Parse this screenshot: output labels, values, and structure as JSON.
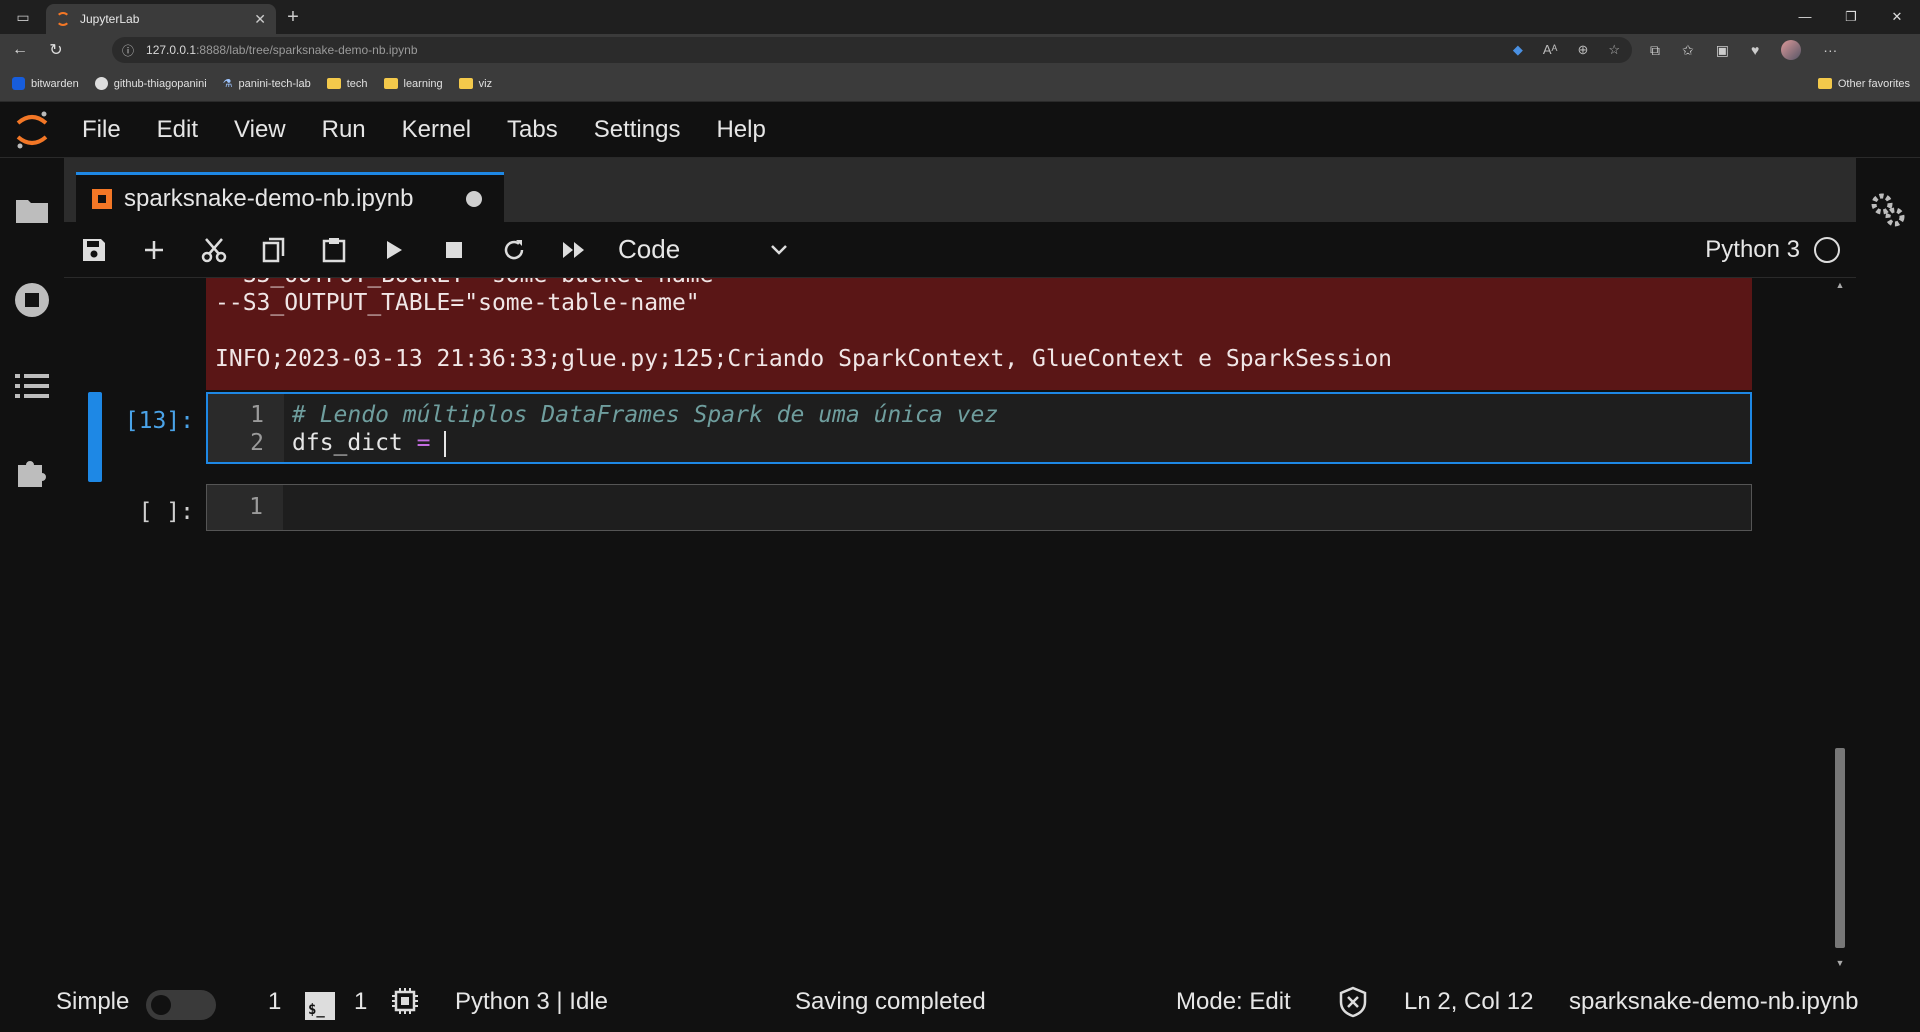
{
  "browser": {
    "tab_title": "JupyterLab",
    "url_host": "127.0.0.1",
    "url_rest": ":8888/lab/tree/sparksnake-demo-nb.ipynb",
    "bookmarks": [
      "bitwarden",
      "github-thiagopanini",
      "panini-tech-lab",
      "tech",
      "learning",
      "viz"
    ],
    "other_favorites": "Other favorites"
  },
  "menu": [
    "File",
    "Edit",
    "View",
    "Run",
    "Kernel",
    "Tabs",
    "Settings",
    "Help"
  ],
  "notebook": {
    "tab_title": "sparksnake-demo-nb.ipynb",
    "cell_type": "Code",
    "kernel": "Python 3"
  },
  "output": {
    "line_partial": "--S3_OUTPUT_BUCKET=\"some-bucket-name\"",
    "line_table": "--S3_OUTPUT_TABLE=\"some-table-name\"",
    "line_info": "INFO;2023-03-13 21:36:33;glue.py;125;Criando SparkContext, GlueContext e SparkSession"
  },
  "cells": [
    {
      "prompt": "[13]:",
      "lines": [
        {
          "num": "1",
          "comment": "# Lendo múltiplos DataFrames Spark de uma única vez"
        },
        {
          "num": "2",
          "var": "dfs_dict ",
          "op": "="
        }
      ]
    },
    {
      "prompt": "[ ]:",
      "lines": [
        {
          "num": "1"
        }
      ]
    }
  ],
  "status": {
    "mode_label": "Simple",
    "terminals_count": "1",
    "kernels_count": "1",
    "kernel_status": "Python 3 | Idle",
    "save_status": "Saving completed",
    "mode": "Mode: Edit",
    "cursor_pos": "Ln 2, Col 12",
    "filename": "sparksnake-demo-nb.ipynb"
  },
  "colors": {
    "accent": "#1e88e5",
    "jupyter_orange": "#f37726",
    "stderr_bg": "#5a1616"
  }
}
